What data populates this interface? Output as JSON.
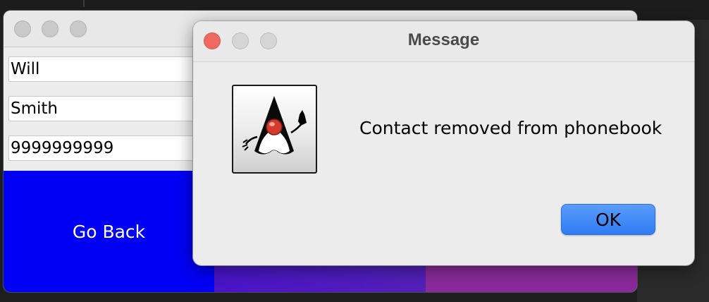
{
  "back_window": {
    "fields": [
      {
        "value": "Will"
      },
      {
        "value": "Smith"
      },
      {
        "value": "9999999999"
      }
    ],
    "go_back_label": "Go Back",
    "panel_colors": [
      "#0000f5",
      "#4a14c8",
      "#8a2a9a"
    ]
  },
  "dialog": {
    "title": "Message",
    "icon": "java-duke-icon",
    "message": "Contact removed from phonebook",
    "ok_label": "OK",
    "accent": "#2f7cf3",
    "close_color": "#ee6a5f"
  }
}
